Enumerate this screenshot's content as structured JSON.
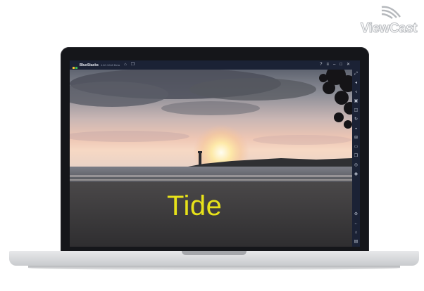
{
  "branding": {
    "logo_text": "ViewCast"
  },
  "window": {
    "app_name": "BlueStacks",
    "version": "4.60.1048 Beta",
    "title_icons": [
      "home-icon",
      "multi-instance-icon"
    ],
    "controls": [
      "help-icon",
      "menu-icon",
      "minimize-icon",
      "restore-icon",
      "close-icon"
    ]
  },
  "sidebar_icons": [
    "fullscreen-icon",
    "volume-up-icon",
    "volume-down-icon",
    "video-record-icon",
    "screenshot-icon",
    "rotate-icon",
    "shake-icon",
    "macro-icon",
    "folder-icon",
    "copy-icon",
    "location-icon",
    "eco-mode-icon",
    "settings-icon",
    "back-icon",
    "home-nav-icon",
    "recent-apps-icon"
  ],
  "video": {
    "caption": "Tide",
    "scene": "sunset-lighthouse"
  },
  "colors": {
    "caption": "#e7e21a",
    "titlebar": "#1b2235",
    "bezel": "#15161a"
  }
}
